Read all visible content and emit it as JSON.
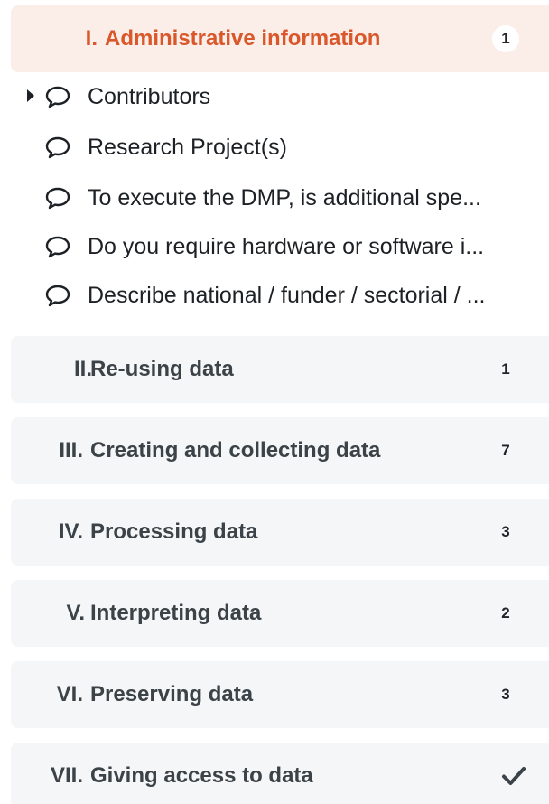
{
  "chapters": [
    {
      "number": "I.",
      "title": "Administrative information",
      "count": "1",
      "active": true
    },
    {
      "number": "II.",
      "title": "Re-using data",
      "count": "1"
    },
    {
      "number": "III.",
      "title": "Creating and collecting data",
      "count": "7"
    },
    {
      "number": "IV.",
      "title": "Processing data",
      "count": "3"
    },
    {
      "number": "V.",
      "title": "Interpreting data",
      "count": "2"
    },
    {
      "number": "VI.",
      "title": "Preserving data",
      "count": "3"
    },
    {
      "number": "VII.",
      "title": "Giving access to data",
      "status_icon": "checkmark-icon"
    }
  ],
  "questions": [
    {
      "label": "Contributors",
      "expandable": true
    },
    {
      "label": "Research Project(s)"
    },
    {
      "label": "To execute the DMP, is additional spe..."
    },
    {
      "label": "Do you require hardware or software i..."
    },
    {
      "label": "Describe national / funder / sectorial / ..."
    }
  ],
  "icons": {
    "question": "comment-bubble-icon",
    "expand": "caret-right-icon"
  },
  "colors": {
    "active_text": "#d9572a",
    "active_bg": "#fbeee8",
    "chapter_bg": "#f5f6f7",
    "text": "#1d2125"
  }
}
